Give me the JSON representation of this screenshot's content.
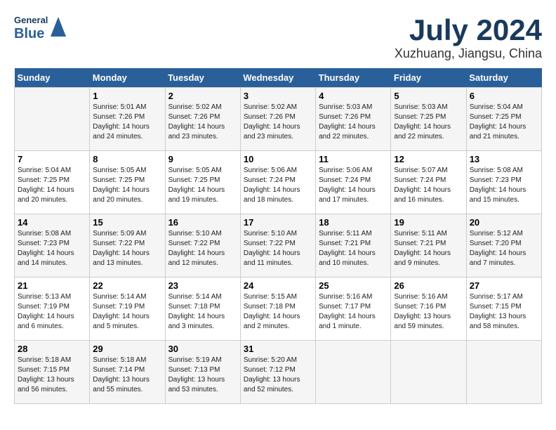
{
  "logo": {
    "general": "General",
    "blue": "Blue"
  },
  "title": "July 2024",
  "subtitle": "Xuzhuang, Jiangsu, China",
  "days_of_week": [
    "Sunday",
    "Monday",
    "Tuesday",
    "Wednesday",
    "Thursday",
    "Friday",
    "Saturday"
  ],
  "weeks": [
    [
      {
        "day": "",
        "info": ""
      },
      {
        "day": "1",
        "info": "Sunrise: 5:01 AM\nSunset: 7:26 PM\nDaylight: 14 hours\nand 24 minutes."
      },
      {
        "day": "2",
        "info": "Sunrise: 5:02 AM\nSunset: 7:26 PM\nDaylight: 14 hours\nand 23 minutes."
      },
      {
        "day": "3",
        "info": "Sunrise: 5:02 AM\nSunset: 7:26 PM\nDaylight: 14 hours\nand 23 minutes."
      },
      {
        "day": "4",
        "info": "Sunrise: 5:03 AM\nSunset: 7:26 PM\nDaylight: 14 hours\nand 22 minutes."
      },
      {
        "day": "5",
        "info": "Sunrise: 5:03 AM\nSunset: 7:25 PM\nDaylight: 14 hours\nand 22 minutes."
      },
      {
        "day": "6",
        "info": "Sunrise: 5:04 AM\nSunset: 7:25 PM\nDaylight: 14 hours\nand 21 minutes."
      }
    ],
    [
      {
        "day": "7",
        "info": "Sunrise: 5:04 AM\nSunset: 7:25 PM\nDaylight: 14 hours\nand 20 minutes."
      },
      {
        "day": "8",
        "info": "Sunrise: 5:05 AM\nSunset: 7:25 PM\nDaylight: 14 hours\nand 20 minutes."
      },
      {
        "day": "9",
        "info": "Sunrise: 5:05 AM\nSunset: 7:25 PM\nDaylight: 14 hours\nand 19 minutes."
      },
      {
        "day": "10",
        "info": "Sunrise: 5:06 AM\nSunset: 7:24 PM\nDaylight: 14 hours\nand 18 minutes."
      },
      {
        "day": "11",
        "info": "Sunrise: 5:06 AM\nSunset: 7:24 PM\nDaylight: 14 hours\nand 17 minutes."
      },
      {
        "day": "12",
        "info": "Sunrise: 5:07 AM\nSunset: 7:24 PM\nDaylight: 14 hours\nand 16 minutes."
      },
      {
        "day": "13",
        "info": "Sunrise: 5:08 AM\nSunset: 7:23 PM\nDaylight: 14 hours\nand 15 minutes."
      }
    ],
    [
      {
        "day": "14",
        "info": "Sunrise: 5:08 AM\nSunset: 7:23 PM\nDaylight: 14 hours\nand 14 minutes."
      },
      {
        "day": "15",
        "info": "Sunrise: 5:09 AM\nSunset: 7:22 PM\nDaylight: 14 hours\nand 13 minutes."
      },
      {
        "day": "16",
        "info": "Sunrise: 5:10 AM\nSunset: 7:22 PM\nDaylight: 14 hours\nand 12 minutes."
      },
      {
        "day": "17",
        "info": "Sunrise: 5:10 AM\nSunset: 7:22 PM\nDaylight: 14 hours\nand 11 minutes."
      },
      {
        "day": "18",
        "info": "Sunrise: 5:11 AM\nSunset: 7:21 PM\nDaylight: 14 hours\nand 10 minutes."
      },
      {
        "day": "19",
        "info": "Sunrise: 5:11 AM\nSunset: 7:21 PM\nDaylight: 14 hours\nand 9 minutes."
      },
      {
        "day": "20",
        "info": "Sunrise: 5:12 AM\nSunset: 7:20 PM\nDaylight: 14 hours\nand 7 minutes."
      }
    ],
    [
      {
        "day": "21",
        "info": "Sunrise: 5:13 AM\nSunset: 7:19 PM\nDaylight: 14 hours\nand 6 minutes."
      },
      {
        "day": "22",
        "info": "Sunrise: 5:14 AM\nSunset: 7:19 PM\nDaylight: 14 hours\nand 5 minutes."
      },
      {
        "day": "23",
        "info": "Sunrise: 5:14 AM\nSunset: 7:18 PM\nDaylight: 14 hours\nand 3 minutes."
      },
      {
        "day": "24",
        "info": "Sunrise: 5:15 AM\nSunset: 7:18 PM\nDaylight: 14 hours\nand 2 minutes."
      },
      {
        "day": "25",
        "info": "Sunrise: 5:16 AM\nSunset: 7:17 PM\nDaylight: 14 hours\nand 1 minute."
      },
      {
        "day": "26",
        "info": "Sunrise: 5:16 AM\nSunset: 7:16 PM\nDaylight: 13 hours\nand 59 minutes."
      },
      {
        "day": "27",
        "info": "Sunrise: 5:17 AM\nSunset: 7:15 PM\nDaylight: 13 hours\nand 58 minutes."
      }
    ],
    [
      {
        "day": "28",
        "info": "Sunrise: 5:18 AM\nSunset: 7:15 PM\nDaylight: 13 hours\nand 56 minutes."
      },
      {
        "day": "29",
        "info": "Sunrise: 5:18 AM\nSunset: 7:14 PM\nDaylight: 13 hours\nand 55 minutes."
      },
      {
        "day": "30",
        "info": "Sunrise: 5:19 AM\nSunset: 7:13 PM\nDaylight: 13 hours\nand 53 minutes."
      },
      {
        "day": "31",
        "info": "Sunrise: 5:20 AM\nSunset: 7:12 PM\nDaylight: 13 hours\nand 52 minutes."
      },
      {
        "day": "",
        "info": ""
      },
      {
        "day": "",
        "info": ""
      },
      {
        "day": "",
        "info": ""
      }
    ]
  ]
}
